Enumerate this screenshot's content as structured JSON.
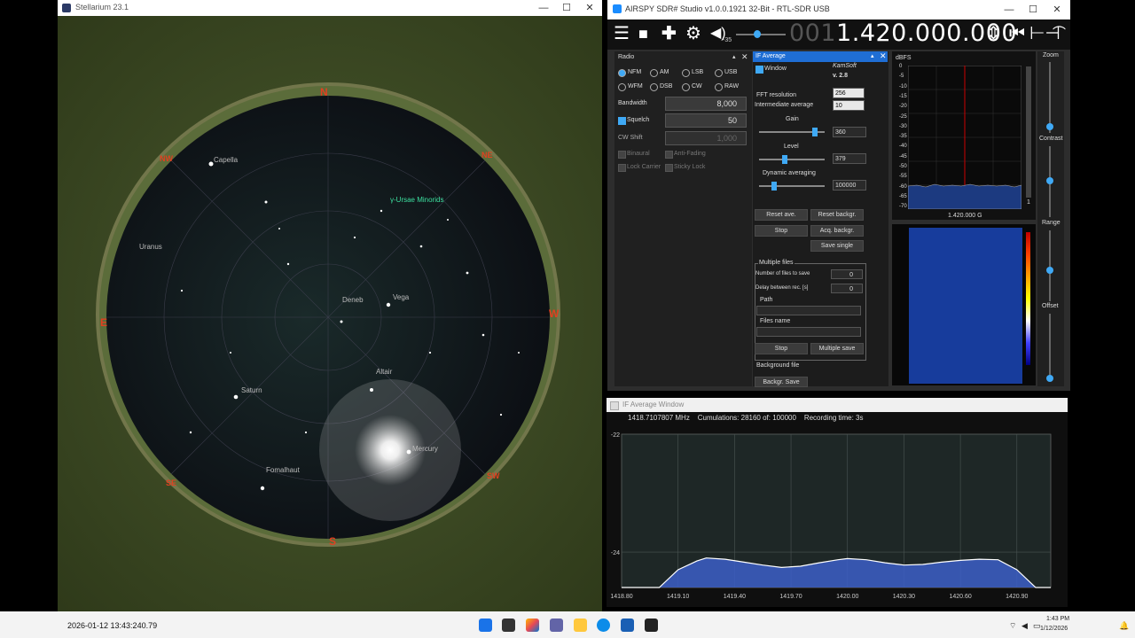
{
  "stellarium": {
    "title": "Stellarium 23.1",
    "objects": {
      "capella": "Capella",
      "uranus": "Uranus",
      "ursae": "γ-Ursae Minorids",
      "deneb": "Deneb",
      "vega": "Vega",
      "altair": "Altair",
      "saturn": "Saturn",
      "fomalhaut": "Fomalhaut",
      "mercury": "Mercury"
    },
    "compass": {
      "n": "N",
      "ne": "NE",
      "e": "E",
      "w": "W",
      "se": "SE",
      "sw": "SW",
      "s": "S",
      "nw": "NW"
    },
    "timestamp": "2026-01-12 13:43:240.79"
  },
  "sdr": {
    "title": "AIRSPY SDR# Studio v1.0.0.1921 32-Bit - RTL-SDR USB",
    "freq_dim": "001",
    "freq_main": ".420.000.000",
    "freq_one": "1",
    "volume_label": "-35",
    "radio": {
      "header": "Radio",
      "modes": [
        "NFM",
        "AM",
        "LSB",
        "USB",
        "WFM",
        "DSB",
        "CW",
        "RAW"
      ],
      "bandwidth_label": "Bandwidth",
      "bandwidth_value": "8,000",
      "squelch_label": "Squelch",
      "squelch_value": "50",
      "cwshift_label": "CW Shift",
      "cwshift_value": "1,000",
      "binaural": "Binaural",
      "antifading": "Anti-Fading",
      "lockcarrier": "Lock Carrier",
      "stickylock": "Sticky Lock"
    },
    "if_average": {
      "header": "IF Average",
      "window_label": "Window",
      "brand": "KamSoft",
      "version": "v. 2.8",
      "fft_label": "FFT resolution",
      "fft_value": "256",
      "intavg_label": "Intermediate average",
      "intavg_value": "10",
      "gain_label": "Gain",
      "gain_value": "360",
      "level_label": "Level",
      "level_value": "379",
      "dynavg_label": "Dynamic averaging",
      "dynavg_value": "100000",
      "reset_ave": "Reset ave.",
      "reset_backgr": "Reset backgr.",
      "stop": "Stop",
      "acq_backgr": "Acq. backgr.",
      "save_single": "Save single",
      "multiple_files": "Multiple files",
      "num_files_label": "Number of files to save",
      "num_files_value": "0",
      "delay_label": "Delay between rec. [s]",
      "delay_value": "0",
      "path_label": "Path",
      "files_name_label": "Files name",
      "stop2": "Stop",
      "multiple_save": "Multiple save",
      "background_file": "Background file",
      "backgr_save": "Backgr. Save"
    },
    "spectrum": {
      "unit": "dBFS",
      "yticks": [
        "0",
        "-5",
        "-10",
        "-15",
        "-20",
        "-25",
        "-30",
        "-35",
        "-40",
        "-45",
        "-50",
        "-55",
        "-60",
        "-65",
        "-70"
      ],
      "center_label": "1.420.000 G",
      "scroll_num": "1"
    },
    "sliders": {
      "zoom": "Zoom",
      "contrast": "Contrast",
      "range": "Range",
      "offset": "Offset"
    }
  },
  "avg_window": {
    "title": "IF Average Window",
    "freq": "1418.7107807 MHz",
    "cumulations": "Cumulations: 28160 of: 100000",
    "recording": "Recording time: 3s"
  },
  "chart_data": {
    "type": "area",
    "title": "",
    "xlabel": "",
    "ylabel": "",
    "xlim": [
      1418.8,
      1421.08
    ],
    "ylim": [
      -24.6,
      -22
    ],
    "x_ticks": [
      "1418.80",
      "1419.10",
      "1419.40",
      "1419.70",
      "1420.00",
      "1420.30",
      "1420.60",
      "1420.90"
    ],
    "y_ticks": [
      "-22",
      "-24"
    ],
    "x": [
      1418.8,
      1419.0,
      1419.1,
      1419.2,
      1419.25,
      1419.35,
      1419.45,
      1419.55,
      1419.65,
      1419.75,
      1419.85,
      1419.95,
      1420.0,
      1420.1,
      1420.2,
      1420.3,
      1420.4,
      1420.5,
      1420.6,
      1420.7,
      1420.8,
      1420.9,
      1421.0,
      1421.08
    ],
    "series": [
      {
        "values": [
          -24.6,
          -24.6,
          -24.3,
          -24.15,
          -24.1,
          -24.12,
          -24.17,
          -24.22,
          -24.26,
          -24.24,
          -24.18,
          -24.13,
          -24.11,
          -24.13,
          -24.18,
          -24.22,
          -24.21,
          -24.17,
          -24.14,
          -24.12,
          -24.13,
          -24.3,
          -24.6,
          -24.6
        ]
      }
    ],
    "grid": true,
    "colors": {
      "fill": "#3c5fc8",
      "line": "#ffffff",
      "bg": "#1e2726"
    }
  },
  "taskbar": {
    "time": "1:43 PM",
    "date": "1/12/2026"
  }
}
